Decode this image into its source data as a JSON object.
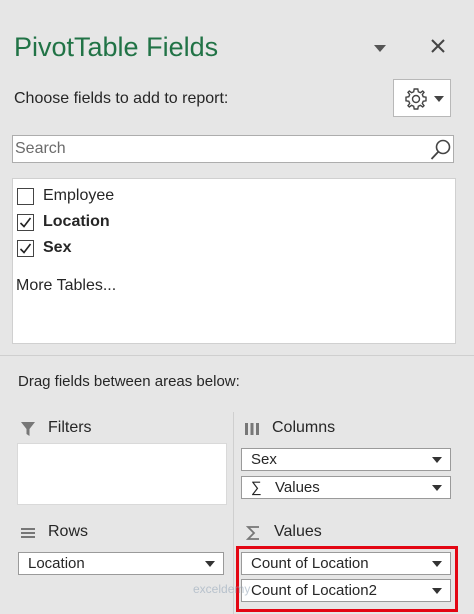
{
  "pane": {
    "title": "PivotTable Fields",
    "choose_label": "Choose fields to add to report:",
    "search_placeholder": "Search"
  },
  "fields": [
    {
      "label": "Employee",
      "checked": false
    },
    {
      "label": "Location",
      "checked": true
    },
    {
      "label": "Sex",
      "checked": true
    }
  ],
  "more_tables": "More Tables...",
  "drag_label": "Drag fields between areas below:",
  "areas": {
    "filters": {
      "label": "Filters",
      "icon": "filter-icon",
      "items": []
    },
    "columns": {
      "label": "Columns",
      "icon": "columns-icon",
      "items": [
        "Sex",
        "Values"
      ]
    },
    "rows": {
      "label": "Rows",
      "icon": "rows-icon",
      "items": [
        "Location"
      ]
    },
    "values": {
      "label": "Values",
      "icon": "sigma-icon",
      "items": [
        "Count of Location",
        "Count of Location2"
      ]
    }
  },
  "columns_values_prefix": "∑",
  "watermark": "exceldemy",
  "colors": {
    "title": "#217346",
    "highlight": "#e30613",
    "background": "#e6e6e6"
  }
}
